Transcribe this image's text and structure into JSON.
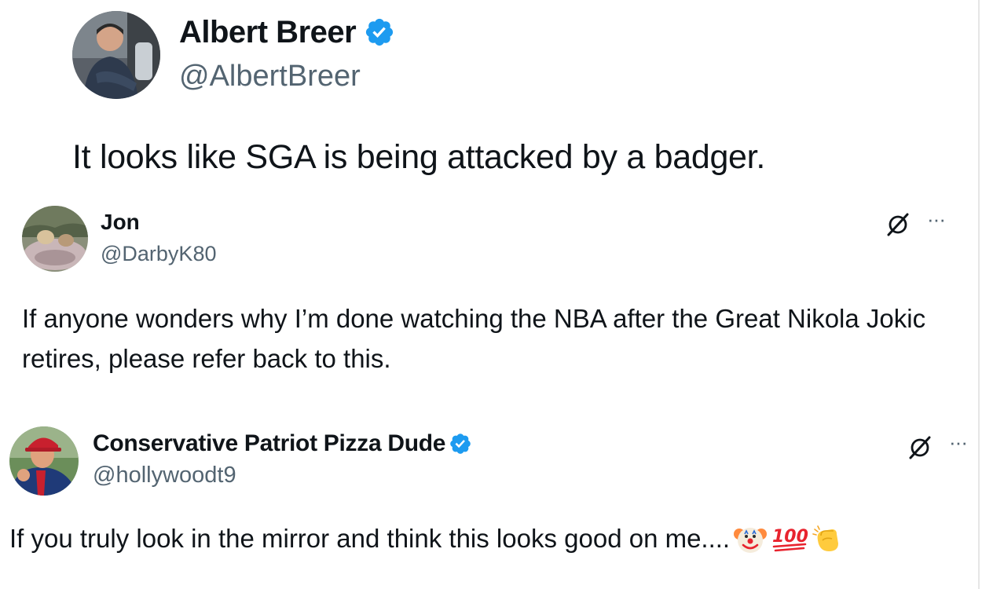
{
  "main_tweet": {
    "display_name": "Albert Breer",
    "verified": true,
    "handle": "@AlbertBreer",
    "text": "It looks like SGA is being attacked by a badger."
  },
  "replies": [
    {
      "display_name": "Jon",
      "verified": false,
      "handle": "@DarbyK80",
      "text": "If anyone wonders why I’m done watching the NBA after the Great Nikola Jokic retires, please refer back to this.",
      "more_label": "···"
    },
    {
      "display_name": "Conservative Patriot Pizza Dude",
      "verified": true,
      "handle": "@hollywoodt9",
      "text": "If you truly look in the mirror and think this looks good on me....",
      "emojis": [
        "clown-face",
        "hundred-points",
        "clapping-hands"
      ],
      "more_label": "···"
    }
  ],
  "colors": {
    "verified_blue": "#1d9bf0",
    "text_primary": "#0f1419",
    "text_secondary": "#536471"
  }
}
